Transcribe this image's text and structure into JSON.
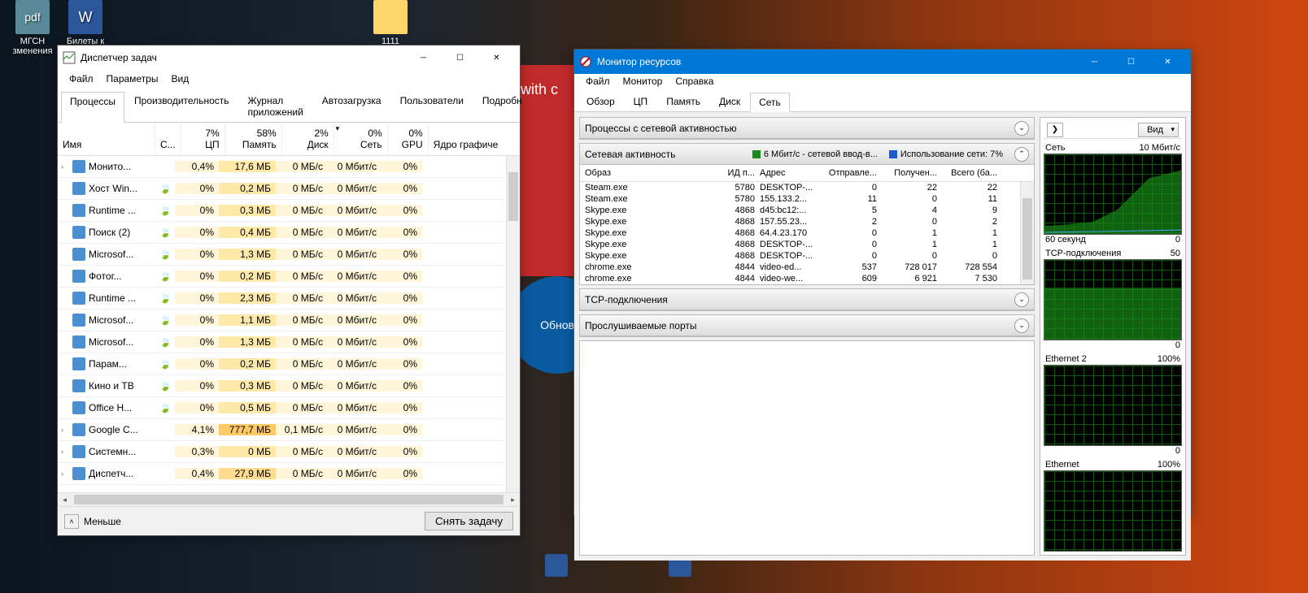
{
  "desktop": {
    "icons": [
      {
        "label": "МГСН\nзменения",
        "type": "pdf",
        "text": "pdf"
      },
      {
        "label": "Билеты к\nгос. экз...",
        "type": "word",
        "text": "W"
      },
      {
        "label": "1111",
        "type": "folder",
        "text": ""
      }
    ]
  },
  "taskManager": {
    "title": "Диспетчер задач",
    "menu": [
      "Файл",
      "Параметры",
      "Вид"
    ],
    "tabs": [
      "Процессы",
      "Производительность",
      "Журнал приложений",
      "Автозагрузка",
      "Пользователи",
      "Подробн"
    ],
    "activeTab": 0,
    "columns": {
      "name": "Имя",
      "status": "С...",
      "cpu": {
        "pct": "7%",
        "label": "ЦП"
      },
      "memory": {
        "pct": "58%",
        "label": "Память"
      },
      "disk": {
        "pct": "2%",
        "label": "Диск"
      },
      "network": {
        "pct": "0%",
        "label": "Сеть"
      },
      "gpu": {
        "pct": "0%",
        "label": "GPU"
      },
      "gpuEngine": "Ядро графиче"
    },
    "rows": [
      {
        "name": "Монито...",
        "leaf": false,
        "cpu": "0,4%",
        "mem": "17,6 МБ",
        "disk": "0 МБ/с",
        "net": "0 Мбит/с",
        "gpu": "0%",
        "hi": ""
      },
      {
        "name": "Хост Win...",
        "leaf": true,
        "cpu": "0%",
        "mem": "0,2 МБ",
        "disk": "0 МБ/с",
        "net": "0 Мбит/с",
        "gpu": "0%",
        "hi": ""
      },
      {
        "name": "Runtime ...",
        "leaf": true,
        "cpu": "0%",
        "mem": "0,3 МБ",
        "disk": "0 МБ/с",
        "net": "0 Мбит/с",
        "gpu": "0%",
        "hi": ""
      },
      {
        "name": "Поиск (2)",
        "leaf": true,
        "cpu": "0%",
        "mem": "0,4 МБ",
        "disk": "0 МБ/с",
        "net": "0 Мбит/с",
        "gpu": "0%",
        "hi": ""
      },
      {
        "name": "Microsof...",
        "leaf": true,
        "cpu": "0%",
        "mem": "1,3 МБ",
        "disk": "0 МБ/с",
        "net": "0 Мбит/с",
        "gpu": "0%",
        "hi": ""
      },
      {
        "name": "Фотог...",
        "leaf": true,
        "cpu": "0%",
        "mem": "0,2 МБ",
        "disk": "0 МБ/с",
        "net": "0 Мбит/с",
        "gpu": "0%",
        "hi": ""
      },
      {
        "name": "Runtime ...",
        "leaf": true,
        "cpu": "0%",
        "mem": "2,3 МБ",
        "disk": "0 МБ/с",
        "net": "0 Мбит/с",
        "gpu": "0%",
        "hi": ""
      },
      {
        "name": "Microsof...",
        "leaf": true,
        "cpu": "0%",
        "mem": "1,1 МБ",
        "disk": "0 МБ/с",
        "net": "0 Мбит/с",
        "gpu": "0%",
        "hi": ""
      },
      {
        "name": "Microsof...",
        "leaf": true,
        "cpu": "0%",
        "mem": "1,3 МБ",
        "disk": "0 МБ/с",
        "net": "0 Мбит/с",
        "gpu": "0%",
        "hi": ""
      },
      {
        "name": "Парам...",
        "leaf": true,
        "cpu": "0%",
        "mem": "0,2 МБ",
        "disk": "0 МБ/с",
        "net": "0 Мбит/с",
        "gpu": "0%",
        "hi": ""
      },
      {
        "name": "Кино и ТВ",
        "leaf": true,
        "cpu": "0%",
        "mem": "0,3 МБ",
        "disk": "0 МБ/с",
        "net": "0 Мбит/с",
        "gpu": "0%",
        "hi": ""
      },
      {
        "name": "Office H...",
        "leaf": true,
        "cpu": "0%",
        "mem": "0,5 МБ",
        "disk": "0 МБ/с",
        "net": "0 Мбит/с",
        "gpu": "0%",
        "hi": ""
      },
      {
        "name": "Google C...",
        "leaf": false,
        "cpu": "4,1%",
        "mem": "777,7 МБ",
        "disk": "0,1 МБ/с",
        "net": "0 Мбит/с",
        "gpu": "0%",
        "hi": "strong"
      },
      {
        "name": "Системн...",
        "leaf": false,
        "cpu": "0,3%",
        "mem": "0 МБ",
        "disk": "0 МБ/с",
        "net": "0 Мбит/с",
        "gpu": "0%",
        "hi": ""
      },
      {
        "name": "Диспетч...",
        "leaf": false,
        "cpu": "0,4%",
        "mem": "27,9 МБ",
        "disk": "0 МБ/с",
        "net": "0 Мбит/с",
        "gpu": "0%",
        "hi": "med"
      }
    ],
    "footer": {
      "less": "Меньше",
      "endTask": "Снять задачу"
    }
  },
  "resourceMonitor": {
    "title": "Монитор ресурсов",
    "menu": [
      "Файл",
      "Монитор",
      "Справка"
    ],
    "tabs": [
      "Обзор",
      "ЦП",
      "Память",
      "Диск",
      "Сеть"
    ],
    "activeTab": 4,
    "sections": {
      "processes": "Процессы с сетевой активностью",
      "activity": {
        "label": "Сетевая активность",
        "throughput": "6 Мбит/с - сетевой ввод-в...",
        "usage": "Использование сети: 7%"
      },
      "tcp": "TCP-подключения",
      "ports": "Прослушиваемые порты"
    },
    "netColumns": [
      "Образ",
      "ИД п...",
      "Адрес",
      "Отправле...",
      "Получен...",
      "Всего (ба..."
    ],
    "netRows": [
      {
        "image": "Steam.exe",
        "pid": "5780",
        "addr": "DESKTOP-...",
        "sent": "0",
        "recv": "22",
        "total": "22"
      },
      {
        "image": "Steam.exe",
        "pid": "5780",
        "addr": "155.133.2...",
        "sent": "11",
        "recv": "0",
        "total": "11"
      },
      {
        "image": "Skype.exe",
        "pid": "4868",
        "addr": "d45:bc12:...",
        "sent": "5",
        "recv": "4",
        "total": "9"
      },
      {
        "image": "Skype.exe",
        "pid": "4868",
        "addr": "157.55.23...",
        "sent": "2",
        "recv": "0",
        "total": "2"
      },
      {
        "image": "Skype.exe",
        "pid": "4868",
        "addr": "64.4.23.170",
        "sent": "0",
        "recv": "1",
        "total": "1"
      },
      {
        "image": "Skype.exe",
        "pid": "4868",
        "addr": "DESKTOP-...",
        "sent": "0",
        "recv": "1",
        "total": "1"
      },
      {
        "image": "Skype.exe",
        "pid": "4868",
        "addr": "DESKTOP-...",
        "sent": "0",
        "recv": "0",
        "total": "0"
      },
      {
        "image": "chrome.exe",
        "pid": "4844",
        "addr": "video-ed...",
        "sent": "537",
        "recv": "728 017",
        "total": "728 554"
      },
      {
        "image": "chrome.exe",
        "pid": "4844",
        "addr": "video-we...",
        "sent": "609",
        "recv": "6 921",
        "total": "7 530"
      }
    ],
    "sidebar": {
      "viewLabel": "Вид",
      "graphs": [
        {
          "title": "Сеть",
          "right": "10 Мбит/с",
          "footerLeft": "60 секунд",
          "footerRight": "0",
          "type": "net"
        },
        {
          "title": "TCP-подключения",
          "right": "50",
          "footerLeft": "",
          "footerRight": "0",
          "type": "tcp"
        },
        {
          "title": "Ethernet 2",
          "right": "100%",
          "footerLeft": "",
          "footerRight": "0",
          "type": "eth"
        },
        {
          "title": "Ethernet",
          "right": "100%",
          "footerLeft": "",
          "footerRight": "",
          "type": "eth"
        }
      ]
    }
  },
  "background": {
    "withText": "with c",
    "circle": "Обнов"
  }
}
